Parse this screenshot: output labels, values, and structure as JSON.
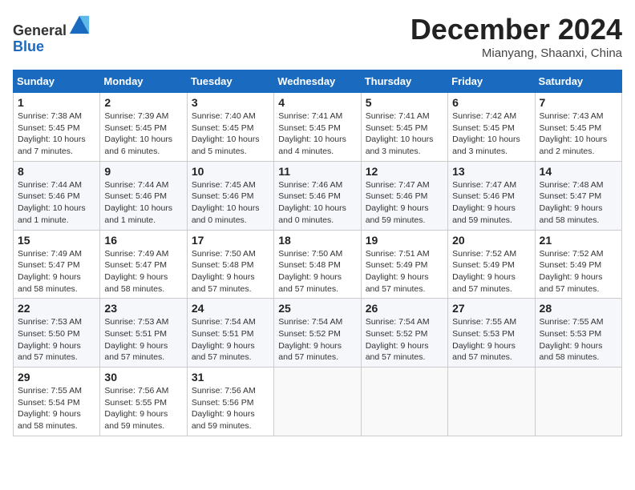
{
  "header": {
    "logo_line1": "General",
    "logo_line2": "Blue",
    "month": "December 2024",
    "location": "Mianyang, Shaanxi, China"
  },
  "weekdays": [
    "Sunday",
    "Monday",
    "Tuesday",
    "Wednesday",
    "Thursday",
    "Friday",
    "Saturday"
  ],
  "weeks": [
    [
      {
        "day": "1",
        "sunrise": "7:38 AM",
        "sunset": "5:45 PM",
        "daylight": "10 hours and 7 minutes."
      },
      {
        "day": "2",
        "sunrise": "7:39 AM",
        "sunset": "5:45 PM",
        "daylight": "10 hours and 6 minutes."
      },
      {
        "day": "3",
        "sunrise": "7:40 AM",
        "sunset": "5:45 PM",
        "daylight": "10 hours and 5 minutes."
      },
      {
        "day": "4",
        "sunrise": "7:41 AM",
        "sunset": "5:45 PM",
        "daylight": "10 hours and 4 minutes."
      },
      {
        "day": "5",
        "sunrise": "7:41 AM",
        "sunset": "5:45 PM",
        "daylight": "10 hours and 3 minutes."
      },
      {
        "day": "6",
        "sunrise": "7:42 AM",
        "sunset": "5:45 PM",
        "daylight": "10 hours and 3 minutes."
      },
      {
        "day": "7",
        "sunrise": "7:43 AM",
        "sunset": "5:45 PM",
        "daylight": "10 hours and 2 minutes."
      }
    ],
    [
      {
        "day": "8",
        "sunrise": "7:44 AM",
        "sunset": "5:46 PM",
        "daylight": "10 hours and 1 minute."
      },
      {
        "day": "9",
        "sunrise": "7:44 AM",
        "sunset": "5:46 PM",
        "daylight": "10 hours and 1 minute."
      },
      {
        "day": "10",
        "sunrise": "7:45 AM",
        "sunset": "5:46 PM",
        "daylight": "10 hours and 0 minutes."
      },
      {
        "day": "11",
        "sunrise": "7:46 AM",
        "sunset": "5:46 PM",
        "daylight": "10 hours and 0 minutes."
      },
      {
        "day": "12",
        "sunrise": "7:47 AM",
        "sunset": "5:46 PM",
        "daylight": "9 hours and 59 minutes."
      },
      {
        "day": "13",
        "sunrise": "7:47 AM",
        "sunset": "5:46 PM",
        "daylight": "9 hours and 59 minutes."
      },
      {
        "day": "14",
        "sunrise": "7:48 AM",
        "sunset": "5:47 PM",
        "daylight": "9 hours and 58 minutes."
      }
    ],
    [
      {
        "day": "15",
        "sunrise": "7:49 AM",
        "sunset": "5:47 PM",
        "daylight": "9 hours and 58 minutes."
      },
      {
        "day": "16",
        "sunrise": "7:49 AM",
        "sunset": "5:47 PM",
        "daylight": "9 hours and 58 minutes."
      },
      {
        "day": "17",
        "sunrise": "7:50 AM",
        "sunset": "5:48 PM",
        "daylight": "9 hours and 57 minutes."
      },
      {
        "day": "18",
        "sunrise": "7:50 AM",
        "sunset": "5:48 PM",
        "daylight": "9 hours and 57 minutes."
      },
      {
        "day": "19",
        "sunrise": "7:51 AM",
        "sunset": "5:49 PM",
        "daylight": "9 hours and 57 minutes."
      },
      {
        "day": "20",
        "sunrise": "7:52 AM",
        "sunset": "5:49 PM",
        "daylight": "9 hours and 57 minutes."
      },
      {
        "day": "21",
        "sunrise": "7:52 AM",
        "sunset": "5:49 PM",
        "daylight": "9 hours and 57 minutes."
      }
    ],
    [
      {
        "day": "22",
        "sunrise": "7:53 AM",
        "sunset": "5:50 PM",
        "daylight": "9 hours and 57 minutes."
      },
      {
        "day": "23",
        "sunrise": "7:53 AM",
        "sunset": "5:51 PM",
        "daylight": "9 hours and 57 minutes."
      },
      {
        "day": "24",
        "sunrise": "7:54 AM",
        "sunset": "5:51 PM",
        "daylight": "9 hours and 57 minutes."
      },
      {
        "day": "25",
        "sunrise": "7:54 AM",
        "sunset": "5:52 PM",
        "daylight": "9 hours and 57 minutes."
      },
      {
        "day": "26",
        "sunrise": "7:54 AM",
        "sunset": "5:52 PM",
        "daylight": "9 hours and 57 minutes."
      },
      {
        "day": "27",
        "sunrise": "7:55 AM",
        "sunset": "5:53 PM",
        "daylight": "9 hours and 57 minutes."
      },
      {
        "day": "28",
        "sunrise": "7:55 AM",
        "sunset": "5:53 PM",
        "daylight": "9 hours and 58 minutes."
      }
    ],
    [
      {
        "day": "29",
        "sunrise": "7:55 AM",
        "sunset": "5:54 PM",
        "daylight": "9 hours and 58 minutes."
      },
      {
        "day": "30",
        "sunrise": "7:56 AM",
        "sunset": "5:55 PM",
        "daylight": "9 hours and 59 minutes."
      },
      {
        "day": "31",
        "sunrise": "7:56 AM",
        "sunset": "5:56 PM",
        "daylight": "9 hours and 59 minutes."
      },
      null,
      null,
      null,
      null
    ]
  ]
}
